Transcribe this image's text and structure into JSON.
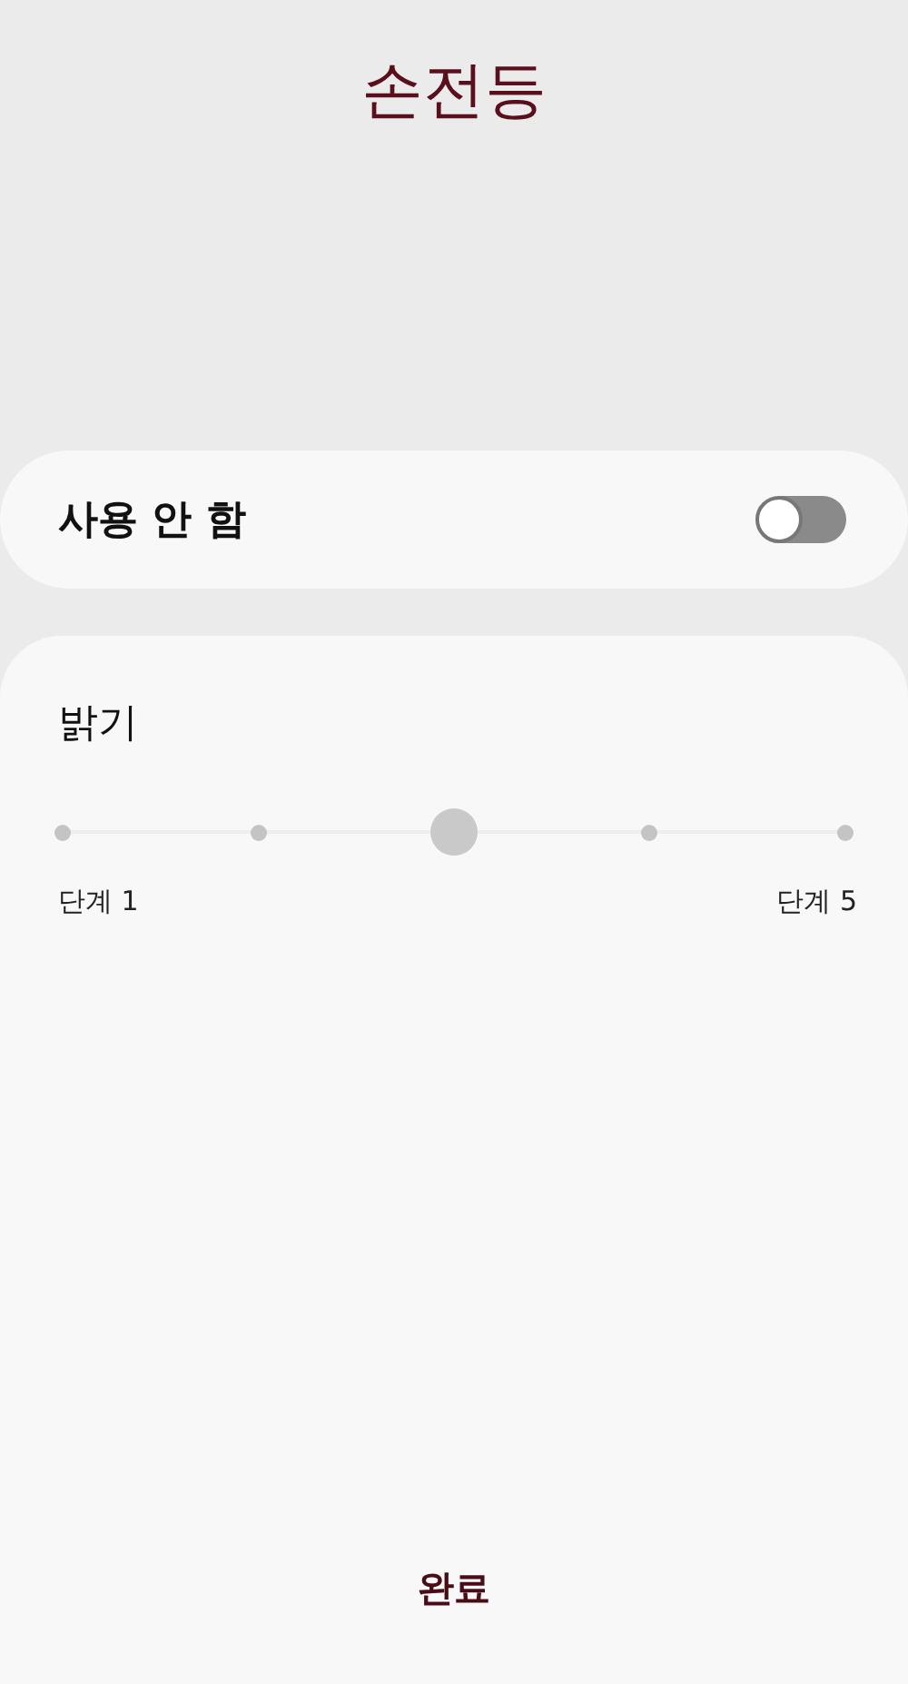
{
  "title": "손전등",
  "switch": {
    "label": "사용 안 함",
    "on": false
  },
  "brightness": {
    "label": "밝기",
    "level": 0.5,
    "min_label": "단계 1",
    "max_label": "단계 5"
  },
  "done_button": "완료"
}
